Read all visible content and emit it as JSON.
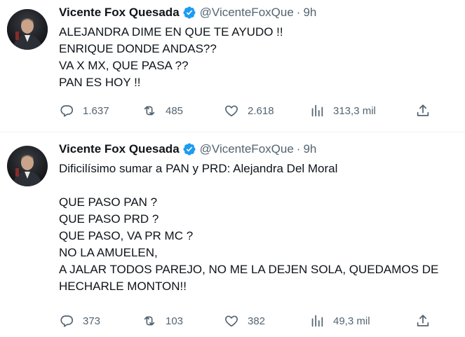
{
  "tweets": [
    {
      "author": {
        "name": "Vicente Fox Quesada",
        "handle": "@VicenteFoxQue",
        "separator": "·",
        "time": "9h",
        "verified": true,
        "avatar_icon": "profile-photo"
      },
      "text_lines": [
        "ALEJANDRA DIME EN QUE TE AYUDO !!",
        "ENRIQUE DONDE ANDAS??",
        "VA X MX, QUE PASA ??",
        "PAN ES HOY !!"
      ],
      "metrics": {
        "replies": "1.637",
        "retweets": "485",
        "likes": "2.618",
        "views": "313,3 mil"
      }
    },
    {
      "author": {
        "name": "Vicente Fox Quesada",
        "handle": "@VicenteFoxQue",
        "separator": "·",
        "time": "9h",
        "verified": true,
        "avatar_icon": "profile-photo"
      },
      "text_lines": [
        "Dificilísimo sumar a PAN y PRD: Alejandra Del Moral",
        "",
        "QUE PASO PAN ?",
        "QUE PASO PRD ?",
        "QUE PASO, VA PR MC ?",
        "NO LA AMUELEN,",
        "A JALAR TODOS PAREJO, NO ME LA DEJEN SOLA, QUEDAMOS DE",
        "HECHARLE MONTON!!"
      ],
      "metrics": {
        "replies": "373",
        "retweets": "103",
        "likes": "382",
        "views": "49,3 mil"
      }
    }
  ],
  "icons": {
    "reply": "reply-icon",
    "retweet": "retweet-icon",
    "like": "heart-icon",
    "views": "views-icon",
    "share": "share-icon",
    "verified": "verified-badge-icon"
  },
  "colors": {
    "text": "#0f1419",
    "secondary": "#536471",
    "verified_blue": "#1d9bf0",
    "divider": "#eff3f4"
  }
}
